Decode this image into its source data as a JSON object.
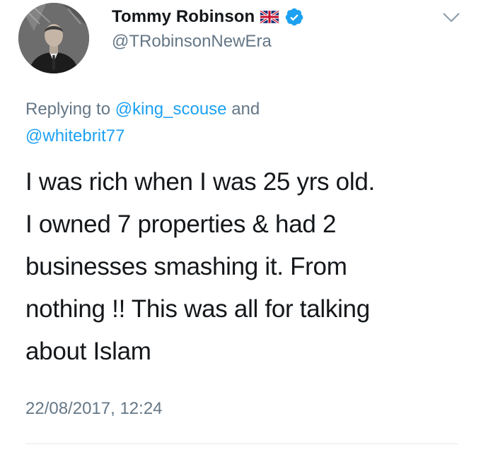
{
  "user": {
    "display_name": "Tommy Robinson",
    "handle": "@TRobinsonNewEra",
    "flag_icon": "uk-flag-icon",
    "verified_icon": "verified-badge-icon",
    "avatar": "profile-photo"
  },
  "menu": {
    "icon": "chevron-down-icon"
  },
  "reply_context": {
    "prefix": "Replying to",
    "mention_1": "@king_scouse",
    "joiner": "and",
    "mention_2": "@whitebrit77"
  },
  "tweet": {
    "lines": [
      "I was rich when I was 25 yrs old.",
      "I owned 7 properties & had 2",
      "businesses smashing it. From",
      "nothing !! This was all for talking",
      "about Islam"
    ],
    "timestamp": "22/08/2017, 12:24"
  },
  "colors": {
    "text_primary": "#14171a",
    "text_secondary": "#657786",
    "link": "#1da1f2",
    "verified": "#1da1f2",
    "divider": "#e1e8ed"
  }
}
